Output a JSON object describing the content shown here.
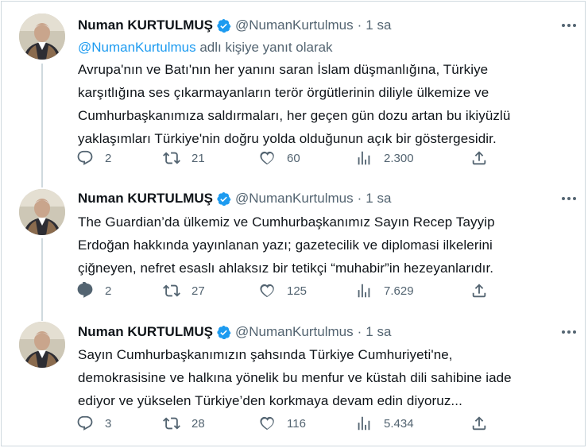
{
  "tweets": [
    {
      "name": "Numan KURTULMUŞ",
      "handle": "@NumanKurtulmus",
      "separator": "·",
      "time": "1 sa",
      "reply_mention": "@NumanKurtulmus",
      "reply_suffix": " adlı kişiye yanıt olarak",
      "text": "Avrupa'nın ve Batı'nın her yanını saran İslam düşmanlığına, Türkiye\nkarşıtlığına ses çıkarmayanların terör örgütlerinin diliyle ülkemize ve\nCumhurbaşkanımıza saldırmaları, her geçen gün dozu artan bu ikiyüzlü\nyaklaşımları Türkiye'nin doğru yolda olduğunun açık bir göstergesidir.",
      "replies": "2",
      "retweets": "21",
      "likes": "60",
      "views": "2.300"
    },
    {
      "name": "Numan KURTULMUŞ",
      "handle": "@NumanKurtulmus",
      "separator": "·",
      "time": "1 sa",
      "text": "The Guardian’da ülkemiz ve Cumhurbaşkanımız Sayın Recep Tayyip\nErdoğan hakkında yayınlanan yazı; gazetecilik ve diplomasi ilkelerini\nçiğneyen, nefret esaslı ahlaksız bir tetikçi “muhabir”in hezeyanlarıdır.",
      "replies": "2",
      "retweets": "27",
      "likes": "125",
      "views": "7.629"
    },
    {
      "name": "Numan KURTULMUŞ",
      "handle": "@NumanKurtulmus",
      "separator": "·",
      "time": "1 sa",
      "text": "Sayın Cumhurbaşkanımızın şahsında Türkiye Cumhuriyeti'ne,\ndemokrasisine ve halkına yönelik bu menfur ve küstah dili sahibine iade\nediyor ve yükselen Türkiye’den korkmaya devam edin diyoruz...",
      "replies": "3",
      "retweets": "28",
      "likes": "116",
      "views": "5.434"
    }
  ],
  "icons": {
    "verified": "verified-badge-icon",
    "more": "more-options-icon",
    "reply": "reply-icon",
    "retweet": "retweet-icon",
    "like": "heart-icon",
    "views": "views-chart-icon",
    "share": "share-icon"
  },
  "colors": {
    "accent": "#1d9bf0",
    "secondary_text": "#536471",
    "primary_text": "#0f1419",
    "border": "#cfd9de"
  }
}
